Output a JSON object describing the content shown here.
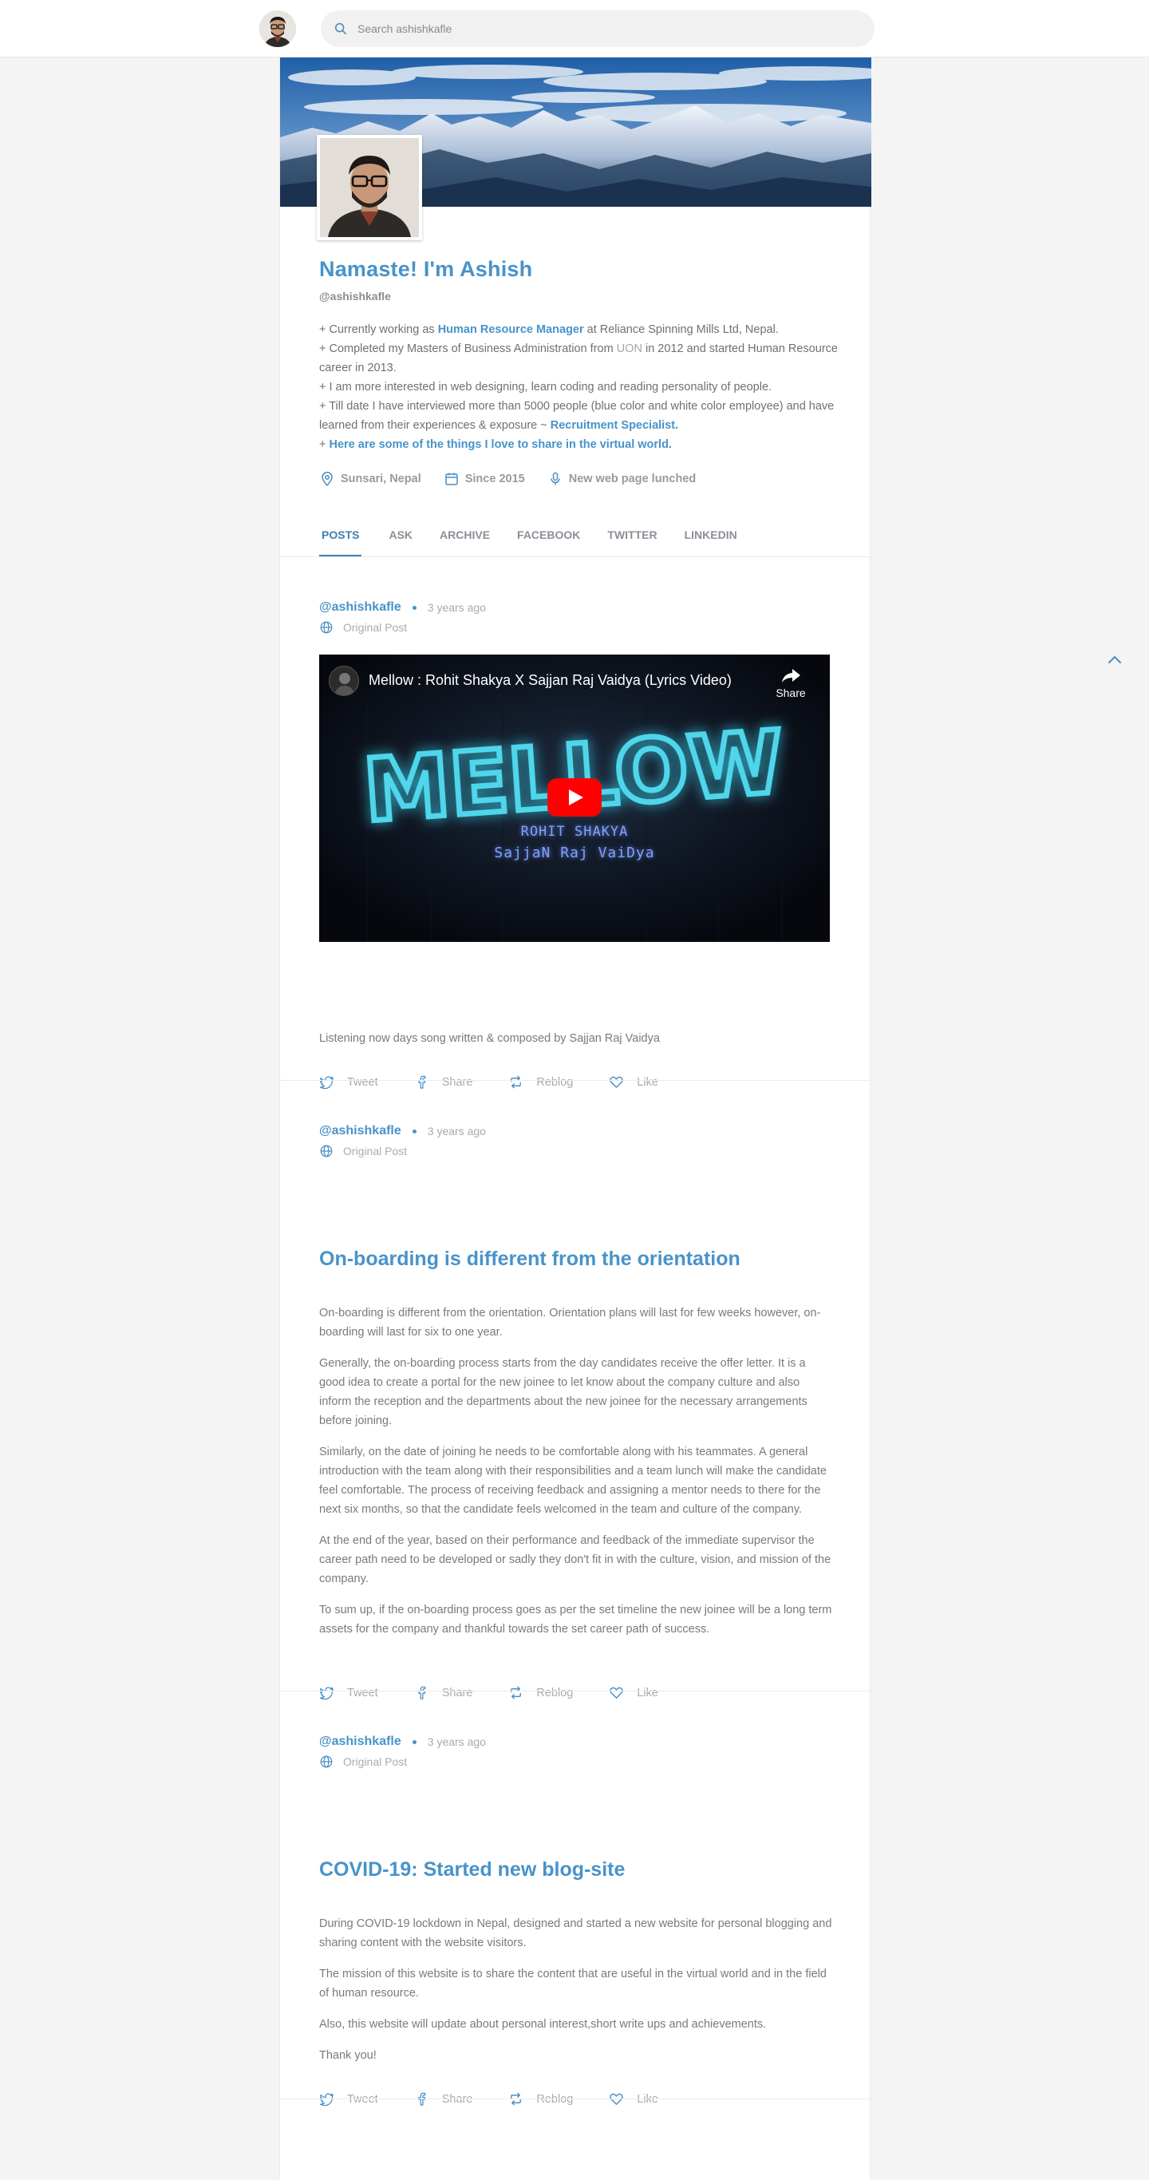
{
  "search": {
    "placeholder": "Search ashishkafle"
  },
  "profile": {
    "title": "Namaste! I'm Ashish",
    "handle": "@ashishkafle",
    "bio": {
      "line1_pre": "+ Currently working as ",
      "line1_link": "Human Resource Manager",
      "line1_post": " at Reliance Spinning Mills Ltd, Nepal.",
      "line2_pre": "+ Completed my Masters of Business Administration from ",
      "line2_muted": "UON",
      "line2_post": " in 2012 and started Human Resource career in 2013.",
      "line3": "+ I am more interested in web designing, learn coding and reading personality of people.",
      "line4_pre": "+ Till date I have interviewed more than 5000 people (blue color and white color employee) and have learned from their experiences & exposure ~ ",
      "line4_link": "Recruitment Specialist.",
      "line5_pre": "+ ",
      "line5_link": "Here are some of the things I love to share in the virtual world."
    },
    "meta": {
      "location": "Sunsari, Nepal",
      "since": "Since 2015",
      "status": "New web page lunched"
    }
  },
  "tabs": [
    "POSTS",
    "ASK",
    "ARCHIVE",
    "FACEBOOK",
    "TWITTER",
    "LINKEDIN"
  ],
  "actions": {
    "tweet": "Tweet",
    "share": "Share",
    "reblog": "Reblog",
    "like": "Like"
  },
  "posts": [
    {
      "author": "@ashishkafle",
      "time": "3 years ago",
      "type": "Original Post",
      "video": {
        "title": "Mellow : Rohit Shakya X Sajjan Raj Vaidya (Lyrics Video)",
        "share": "Share",
        "neon_main": "MELLOW",
        "neon_line1": "ROHIT SHAKYA",
        "neon_line2": "SajjaN Raj VaiDya"
      },
      "body": [
        "Listening now days song written & composed by Sajjan Raj Vaidya"
      ]
    },
    {
      "author": "@ashishkafle",
      "time": "3 years ago",
      "type": "Original Post",
      "title": "On-boarding is different from the orientation",
      "body": [
        "On-boarding is different from the orientation. Orientation plans will last for few weeks however, on-boarding will last for six to one year.",
        "Generally, the on-boarding process starts from the day candidates receive the offer letter. It is a good idea to create a portal for the new joinee to let know about the company culture and also inform the reception and the departments about the new joinee for the necessary arrangements before joining.",
        "Similarly, on the date of joining he needs to be comfortable along with his teammates. A general introduction with the team along with their responsibilities and a team lunch will make the candidate feel comfortable. The process of receiving feedback and assigning a mentor needs to there for the next six months, so that the candidate feels welcomed in the team and culture of the company.",
        "At the end of the year, based on their performance and feedback of the immediate supervisor the career path need to be developed or sadly they don't fit in with the culture, vision, and mission of the company.",
        "To sum up, if the on-boarding process goes as per the set timeline the new joinee will be a long term assets for the company and thankful towards the set career path of success."
      ]
    },
    {
      "author": "@ashishkafle",
      "time": "3 years ago",
      "type": "Original Post",
      "title": "COVID-19: Started new blog-site",
      "body": [
        "During COVID-19 lockdown in Nepal, designed and started a new website for personal blogging and sharing content with the website visitors.",
        "The mission of this website is to share the content that are useful in the virtual world and in the field of human resource.",
        "Also, this website will update about personal interest,short write ups and achievements.",
        "Thank you!"
      ]
    }
  ],
  "colors": {
    "accent": "#4893c9",
    "tab_active": "#3f7fb1",
    "muted": "#a9a9a9"
  }
}
